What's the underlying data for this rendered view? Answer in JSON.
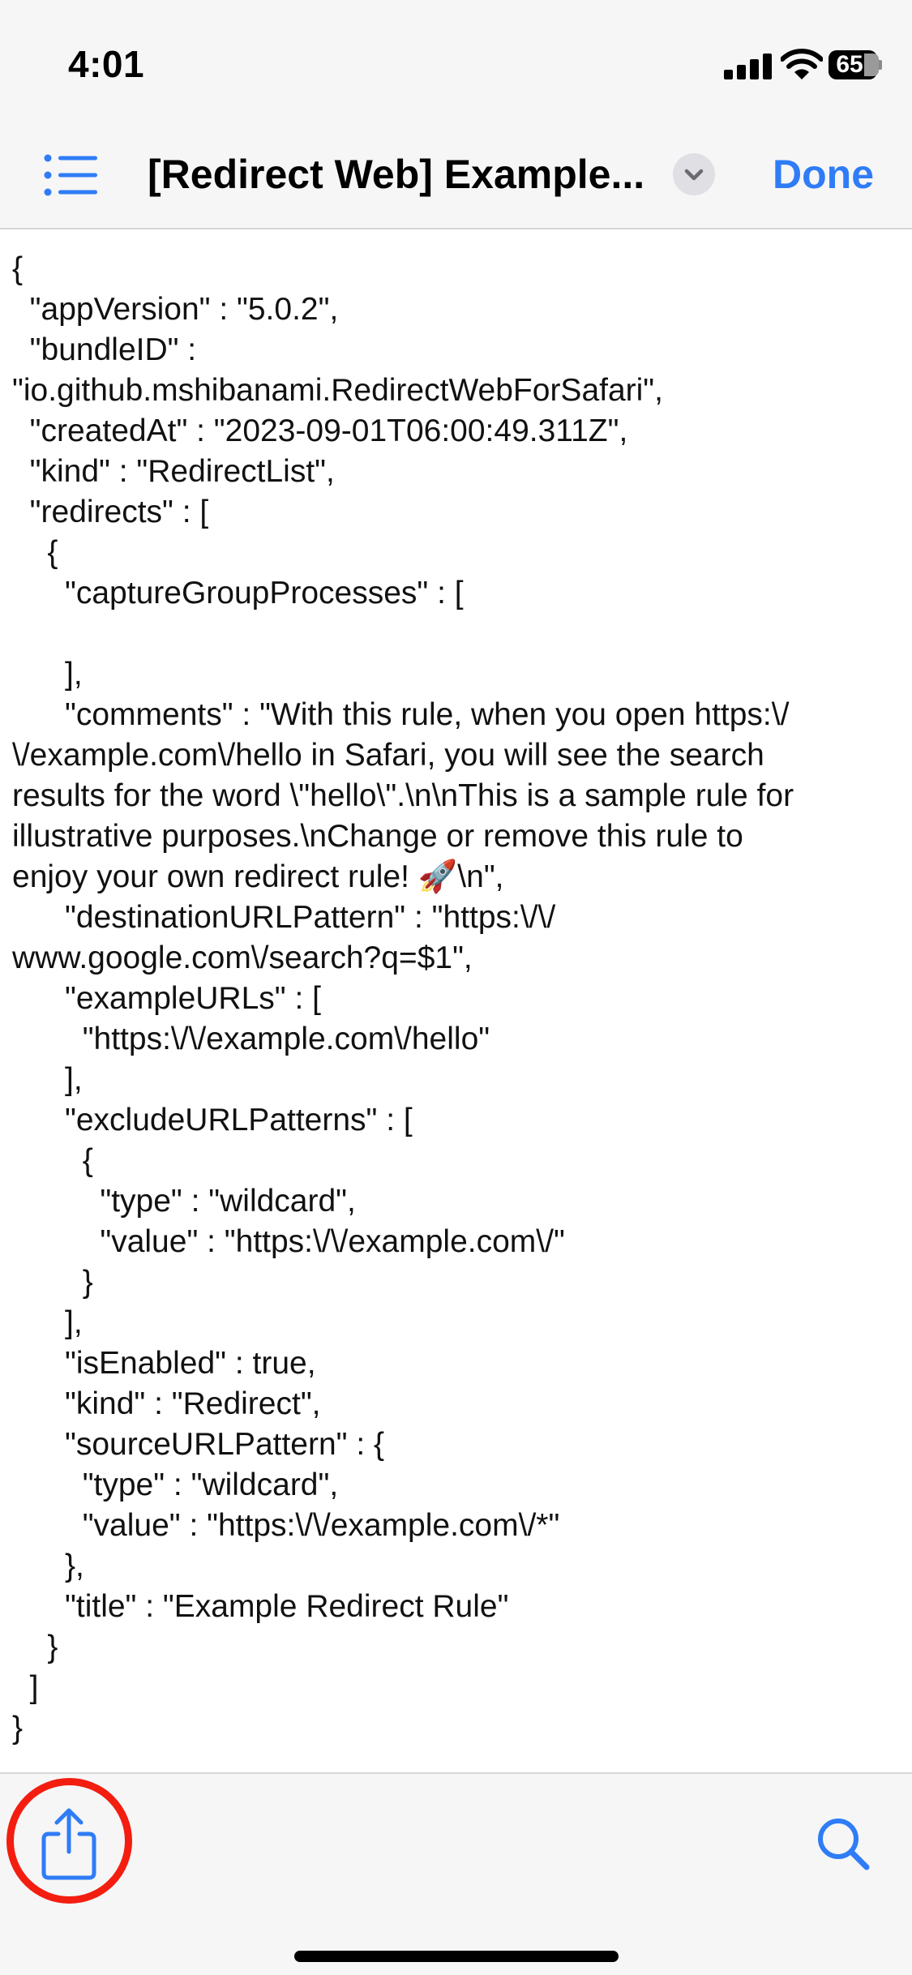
{
  "status_bar": {
    "time": "4:01",
    "battery_level": "65",
    "icons": [
      "signal-icon",
      "wifi-icon",
      "battery-icon"
    ]
  },
  "nav_bar": {
    "title": "[Redirect Web] Example...",
    "done_label": "Done",
    "list_icon": "list-icon",
    "chevron_icon": "chevron-down-icon"
  },
  "document": {
    "lines": [
      "{",
      "  \"appVersion\" : \"5.0.2\",",
      "  \"bundleID\" :",
      "\"io.github.mshibanami.RedirectWebForSafari\",",
      "  \"createdAt\" : \"2023-09-01T06:00:49.311Z\",",
      "  \"kind\" : \"RedirectList\",",
      "  \"redirects\" : [",
      "    {",
      "      \"captureGroupProcesses\" : [",
      "",
      "      ],",
      "      \"comments\" : \"With this rule, when you open https:\\/",
      "\\/example.com\\/hello in Safari, you will see the search",
      "results for the word \\\"hello\\\".\\n\\nThis is a sample rule for",
      "illustrative purposes.\\nChange or remove this rule to",
      "enjoy your own redirect rule! 🚀\\n\",",
      "      \"destinationURLPattern\" : \"https:\\/\\/",
      "www.google.com\\/search?q=$1\",",
      "      \"exampleURLs\" : [",
      "        \"https:\\/\\/example.com\\/hello\"",
      "      ],",
      "      \"excludeURLPatterns\" : [",
      "        {",
      "          \"type\" : \"wildcard\",",
      "          \"value\" : \"https:\\/\\/example.com\\/\"",
      "        }",
      "      ],",
      "      \"isEnabled\" : true,",
      "      \"kind\" : \"Redirect\",",
      "      \"sourceURLPattern\" : {",
      "        \"type\" : \"wildcard\",",
      "        \"value\" : \"https:\\/\\/example.com\\/*\"",
      "      },",
      "      \"title\" : \"Example Redirect Rule\"",
      "    }",
      "  ]",
      "}"
    ]
  },
  "toolbar": {
    "share_icon": "share-icon",
    "search_icon": "search-icon",
    "highlight_color": "#f31d10"
  },
  "colors": {
    "accent": "#2f7cf6",
    "bar_background": "#f6f6f6"
  }
}
